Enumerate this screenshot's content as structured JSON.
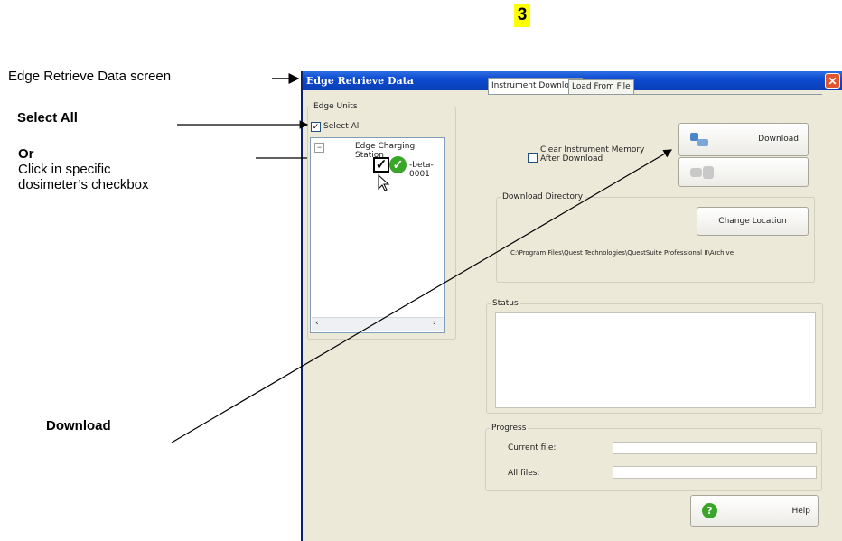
{
  "page_number": "3",
  "annotations": {
    "retrieve_screen": "Edge Retrieve Data screen",
    "select_all": "Select All",
    "or": "Or",
    "click_specific_line1": "Click in specific",
    "click_specific_line2": "dosimeter’s checkbox",
    "download": "Download"
  },
  "window": {
    "title": "Edge Retrieve Data",
    "close_glyph": "✕",
    "edge_units": {
      "label": "Edge Units",
      "select_all_label": "Select All",
      "select_all_checked": true,
      "tree_root": "Edge Charging Station",
      "tree_device": "-beta-0001",
      "collapse_glyph": "−",
      "scroll_left": "‹",
      "scroll_right": "›"
    },
    "tabs": [
      {
        "label": "Instrument Download",
        "active": true
      },
      {
        "label": "Load From File",
        "active": false
      }
    ],
    "download_panel": {
      "clear_memory_line1": "Clear Instrument Memory",
      "clear_memory_line2": "After Download",
      "download_button": "Download",
      "disabled_button": "",
      "directory_group": "Download Directory",
      "change_location_button": "Change Location",
      "path": "C:\\Program Files\\Quest Technologies\\QuestSuite Professional II\\Archive"
    },
    "status_group": "Status",
    "progress": {
      "label": "Progress",
      "current_file": "Current file:",
      "all_files": "All files:"
    },
    "help_button": "Help"
  },
  "colors": {
    "titlebar": "#0d4bd0",
    "window_bg": "#ece9d8",
    "highlight": "#ffff00"
  }
}
